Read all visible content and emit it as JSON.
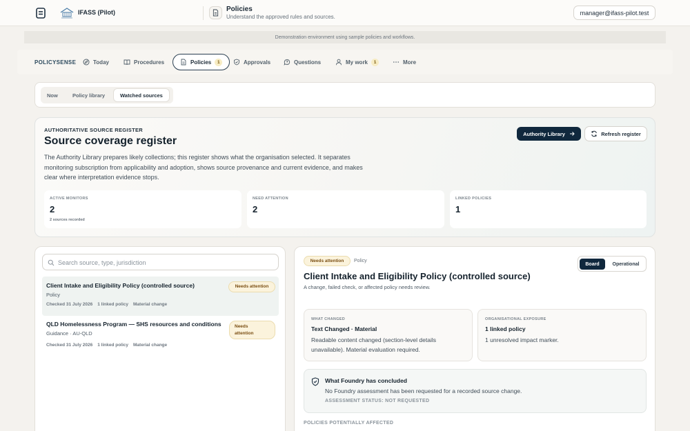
{
  "header": {
    "org_name": "IFASS (Pilot)",
    "page_title": "Policies",
    "page_subtitle": "Understand the approved rules and sources.",
    "user_email": "manager@ifass-pilot.test"
  },
  "banner": "Demonstration environment using sample policies and workflows.",
  "nav": {
    "brand": "POLICYSENSE",
    "items": [
      {
        "label": "Today",
        "icon": "compass-icon"
      },
      {
        "label": "Procedures",
        "icon": "book-icon"
      },
      {
        "label": "Policies",
        "icon": "document-icon",
        "badge": "1",
        "active": true
      },
      {
        "label": "Approvals",
        "icon": "shield-check-icon"
      },
      {
        "label": "Questions",
        "icon": "help-icon"
      },
      {
        "label": "My work",
        "icon": "user-icon",
        "badge": "1"
      },
      {
        "label": "More",
        "icon": "ellipsis-icon"
      }
    ]
  },
  "subtabs": [
    {
      "label": "Now"
    },
    {
      "label": "Policy library"
    },
    {
      "label": "Watched sources",
      "active": true
    }
  ],
  "register": {
    "kicker": "AUTHORITATIVE SOURCE REGISTER",
    "title": "Source coverage register",
    "description": "The Authority Library prepares likely collections; this register shows what the organisation selected. It separates monitoring subscription from applicability and adoption, shows source provenance and current evidence, and makes clear where interpretation evidence stops.",
    "primary_button": "Authority Library",
    "secondary_button": "Refresh register",
    "stats": [
      {
        "label": "ACTIVE MONITORS",
        "value": "2",
        "note": "2 sources recorded"
      },
      {
        "label": "NEED ATTENTION",
        "value": "2"
      },
      {
        "label": "LINKED POLICIES",
        "value": "1"
      }
    ]
  },
  "search": {
    "placeholder": "Search source, type, jurisdiction"
  },
  "sources": [
    {
      "title": "Client Intake and Eligibility Policy (controlled source)",
      "subtitle": "Policy",
      "checked": "Checked 31 July 2026",
      "linked": "1 linked policy",
      "change": "Material change",
      "status": "Needs attention"
    },
    {
      "title": "QLD Homelessness Program — SHS resources and conditions",
      "subtitle": "Guidance · AU-QLD",
      "checked": "Checked 31 July 2026",
      "linked": "1 linked policy",
      "change": "Material change",
      "status_line1": "Needs",
      "status_line2": "attention"
    }
  ],
  "detail": {
    "status": "Needs attention",
    "type": "Policy",
    "view_board": "Board",
    "view_operational": "Operational",
    "title": "Client Intake and Eligibility Policy (controlled source)",
    "subtitle": "A change, failed check, or affected policy needs review.",
    "what_changed": {
      "label": "WHAT CHANGED",
      "head": "Text Changed · Material",
      "body": "Readable content changed (section-level details unavailable). Material evaluation required."
    },
    "exposure": {
      "label": "ORGANISATIONAL EXPOSURE",
      "head": "1 linked policy",
      "body": "1 unresolved impact marker."
    },
    "concluded": {
      "title": "What Foundry has concluded",
      "body": "No Foundry assessment has been requested for a recorded source change.",
      "status": "ASSESSMENT STATUS: NOT REQUESTED"
    },
    "affected_label": "POLICIES POTENTIALLY AFFECTED"
  },
  "colors": {
    "primary_dark": "#10283d",
    "attention_bg": "#fbf3dc",
    "attention_text": "#7a4e12",
    "page_bg": "#f4f2ee"
  }
}
